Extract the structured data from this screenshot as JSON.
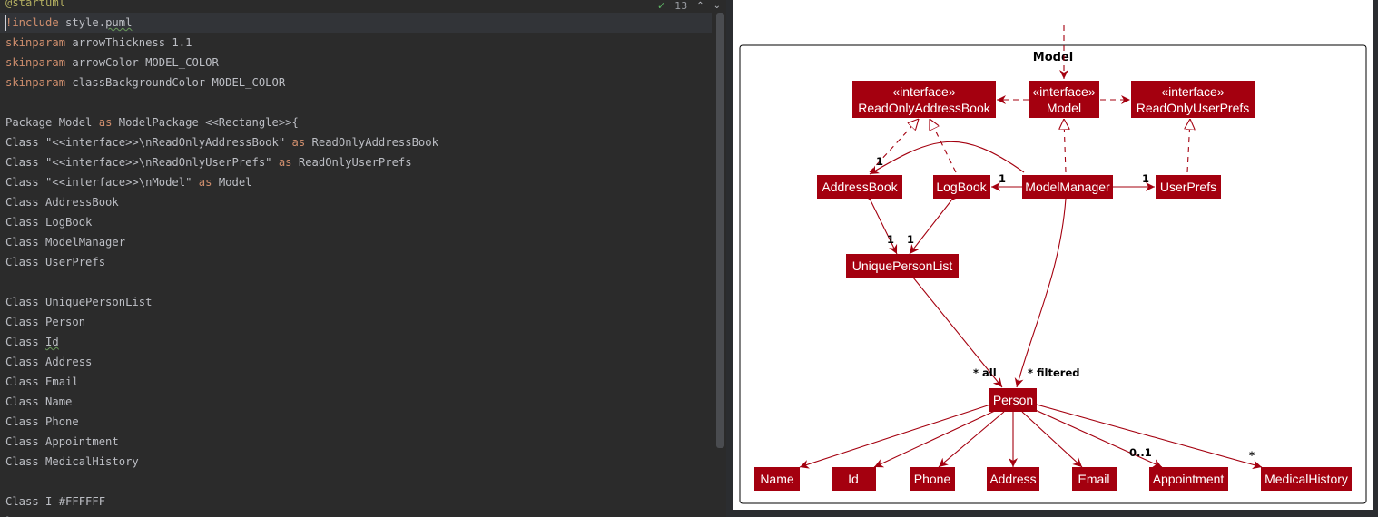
{
  "editor": {
    "inspection_count": "13",
    "lines": [
      [
        {
          "t": "@startuml",
          "c": "anno"
        }
      ],
      [
        {
          "t": "!include ",
          "c": "kw"
        },
        {
          "t": "style.",
          "c": "plain"
        },
        {
          "t": "puml",
          "c": "plain",
          "u": true
        }
      ],
      [
        {
          "t": "skinparam ",
          "c": "kw"
        },
        {
          "t": "arrowThickness 1.1",
          "c": "plain"
        }
      ],
      [
        {
          "t": "skinparam ",
          "c": "kw"
        },
        {
          "t": "arrowColor MODEL_COLOR",
          "c": "plain"
        }
      ],
      [
        {
          "t": "skinparam ",
          "c": "kw"
        },
        {
          "t": "classBackgroundColor MODEL_COLOR",
          "c": "plain"
        }
      ],
      [
        {
          "t": "",
          "c": "plain"
        }
      ],
      [
        {
          "t": "Package Model ",
          "c": "plain"
        },
        {
          "t": "as ",
          "c": "kw"
        },
        {
          "t": "ModelPackage <<Rectangle>>{",
          "c": "plain"
        }
      ],
      [
        {
          "t": "Class \"<<interface>>\\nReadOnlyAddressBook\" ",
          "c": "plain"
        },
        {
          "t": "as ",
          "c": "kw"
        },
        {
          "t": "ReadOnlyAddressBook",
          "c": "plain"
        }
      ],
      [
        {
          "t": "Class \"<<interface>>\\nReadOnlyUserPrefs\" ",
          "c": "plain"
        },
        {
          "t": "as ",
          "c": "kw"
        },
        {
          "t": "ReadOnlyUserPrefs",
          "c": "plain"
        }
      ],
      [
        {
          "t": "Class \"<<interface>>\\nModel\" ",
          "c": "plain"
        },
        {
          "t": "as ",
          "c": "kw"
        },
        {
          "t": "Model",
          "c": "plain"
        }
      ],
      [
        {
          "t": "Class AddressBook",
          "c": "plain"
        }
      ],
      [
        {
          "t": "Class LogBook",
          "c": "plain"
        }
      ],
      [
        {
          "t": "Class ModelManager",
          "c": "plain"
        }
      ],
      [
        {
          "t": "Class UserPrefs",
          "c": "plain"
        }
      ],
      [
        {
          "t": "",
          "c": "plain"
        }
      ],
      [
        {
          "t": "Class UniquePersonList",
          "c": "plain"
        }
      ],
      [
        {
          "t": "Class Person",
          "c": "plain"
        }
      ],
      [
        {
          "t": "Class ",
          "c": "plain"
        },
        {
          "t": "Id",
          "c": "plain",
          "u": true
        }
      ],
      [
        {
          "t": "Class Address",
          "c": "plain"
        }
      ],
      [
        {
          "t": "Class Email",
          "c": "plain"
        }
      ],
      [
        {
          "t": "Class Name",
          "c": "plain"
        }
      ],
      [
        {
          "t": "Class Phone",
          "c": "plain"
        }
      ],
      [
        {
          "t": "Class Appointment",
          "c": "plain"
        }
      ],
      [
        {
          "t": "Class MedicalHistory",
          "c": "plain"
        }
      ],
      [
        {
          "t": "",
          "c": "plain"
        }
      ],
      [
        {
          "t": "Class I #FFFFFF",
          "c": "plain"
        }
      ],
      [
        {
          "t": "}",
          "c": "plain"
        }
      ]
    ]
  },
  "diagram": {
    "package_title": "Model",
    "classes": {
      "roab_stereo": "«interface»",
      "roab_name": "ReadOnlyAddressBook",
      "model_stereo": "«interface»",
      "model_name": "Model",
      "roup_stereo": "«interface»",
      "roup_name": "ReadOnlyUserPrefs",
      "addressbook": "AddressBook",
      "logbook": "LogBook",
      "modelmanager": "ModelManager",
      "userprefs": "UserPrefs",
      "uniquepersonlist": "UniquePersonList",
      "person": "Person",
      "name": "Name",
      "id": "Id",
      "phone": "Phone",
      "address": "Address",
      "email": "Email",
      "appointment": "Appointment",
      "medicalhistory": "MedicalHistory"
    },
    "multiplicities": {
      "ab_from_mm": "1",
      "lb_from_mm": "1",
      "up_from_mm": "1",
      "upl_from_ab": "1",
      "upl_from_lb": "1",
      "person_all": "* all",
      "person_filtered": "* filtered",
      "appointment": "0..1",
      "medicalhistory": "*"
    },
    "color": "#a4000f"
  }
}
